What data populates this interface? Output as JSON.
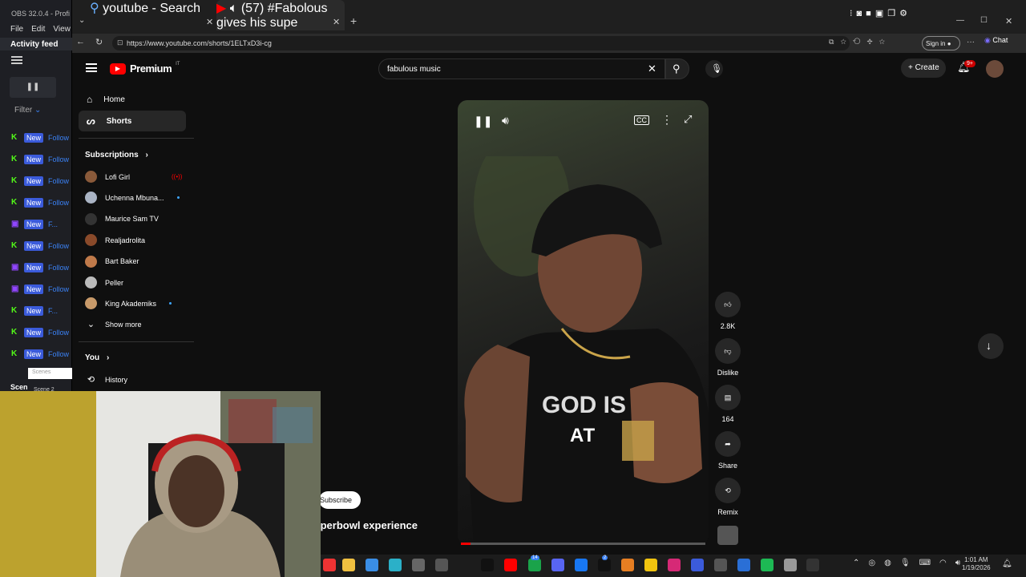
{
  "obs": {
    "title": "OBS 32.0.4 - Profi",
    "menu": [
      "File",
      "Edit",
      "View"
    ],
    "activity_feed": "Activity feed",
    "filter": "Filter",
    "feed_items": [
      {
        "platform": "kick",
        "badge": "New",
        "label": "Follow"
      },
      {
        "platform": "kick",
        "badge": "New",
        "label": "Follow"
      },
      {
        "platform": "kick",
        "badge": "New",
        "label": "Follow"
      },
      {
        "platform": "kick",
        "badge": "New",
        "label": "Follow"
      },
      {
        "platform": "twitch",
        "badge": "New",
        "label": "F..."
      },
      {
        "platform": "kick",
        "badge": "New",
        "label": "Follow"
      },
      {
        "platform": "twitch",
        "badge": "New",
        "label": "Follow"
      },
      {
        "platform": "twitch",
        "badge": "New",
        "label": "Follow"
      },
      {
        "platform": "kick",
        "badge": "New",
        "label": "F..."
      },
      {
        "platform": "kick",
        "badge": "New",
        "label": "Follow"
      },
      {
        "platform": "kick",
        "badge": "New",
        "label": "Follow"
      }
    ],
    "scenes_label": "Scen",
    "scenes_input_placeholder": "Scenes",
    "scene2": "Scene 2"
  },
  "browser": {
    "tabs": [
      {
        "title": "youtube - Search"
      },
      {
        "title": "(57) #Fabolous gives his supe"
      }
    ],
    "url": "https://www.youtube.com/shorts/1ELTxD3i-cg",
    "signin": "Sign in",
    "chat": "Chat"
  },
  "youtube": {
    "brand": "Premium",
    "brand_sup": "IT",
    "search_value": "fabulous music",
    "create": "Create",
    "notif_count": "9+",
    "nav": [
      {
        "label": "Home",
        "icon": "home-icon"
      },
      {
        "label": "Shorts",
        "icon": "shorts-icon"
      }
    ],
    "subscriptions_title": "Subscriptions",
    "subscriptions": [
      {
        "name": "Lofi Girl",
        "live": true
      },
      {
        "name": "Uchenna Mbuna...",
        "dot": true
      },
      {
        "name": "Maurice Sam TV"
      },
      {
        "name": "Realjadrolita"
      },
      {
        "name": "Bart Baker"
      },
      {
        "name": "Peller"
      },
      {
        "name": "King Akademiks",
        "dot": true
      }
    ],
    "show_more": "Show more",
    "you": "You",
    "history": "History",
    "video": {
      "caption": "AT",
      "subscribe": "Subscribe",
      "title": "Superbowl experience"
    },
    "actions": {
      "likes": "2.8K",
      "dislike": "Dislike",
      "comments": "164",
      "share": "Share",
      "remix": "Remix"
    }
  },
  "taskbar": {
    "time": "1:01 AM",
    "date": "1/19/2026",
    "teams_badge": "14",
    "x_badge": "2"
  }
}
